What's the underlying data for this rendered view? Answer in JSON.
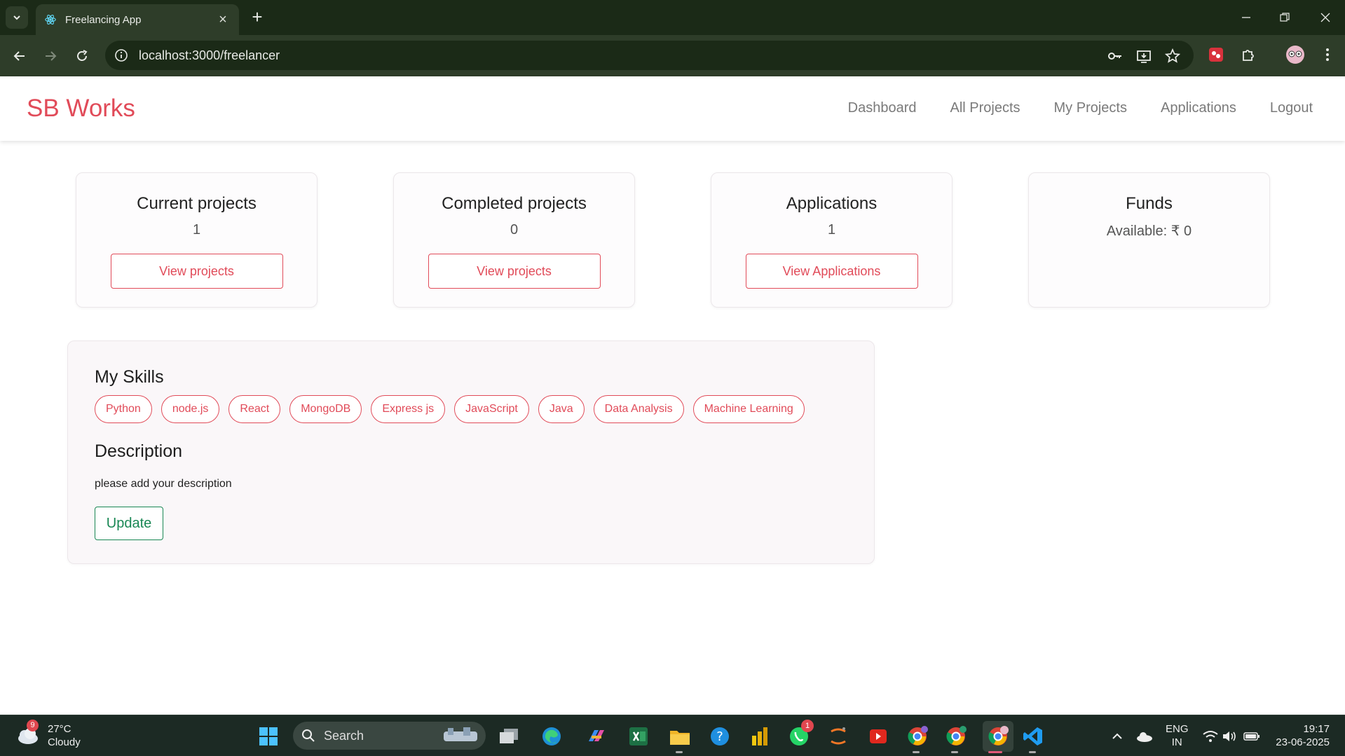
{
  "browser": {
    "tab_title": "Freelancing App",
    "url": "localhost:3000/freelancer"
  },
  "app": {
    "brand": "SB Works",
    "nav": [
      "Dashboard",
      "All Projects",
      "My Projects",
      "Applications",
      "Logout"
    ]
  },
  "cards": [
    {
      "title": "Current projects",
      "value": "1",
      "button": "View projects"
    },
    {
      "title": "Completed projects",
      "value": "0",
      "button": "View projects"
    },
    {
      "title": "Applications",
      "value": "1",
      "button": "View Applications"
    },
    {
      "title": "Funds",
      "value": "Available: ₹ 0"
    }
  ],
  "profile": {
    "skills_heading": "My Skills",
    "skills": [
      "Python",
      "node.js",
      "React",
      "MongoDB",
      "Express js",
      "JavaScript",
      "Java",
      "Data Analysis",
      "Machine Learning"
    ],
    "description_heading": "Description",
    "description": "please add your description",
    "update_label": "Update"
  },
  "taskbar": {
    "weather_temp": "27°C",
    "weather_desc": "Cloudy",
    "weather_badge": "9",
    "search_label": "Search",
    "whatsapp_badge": "1",
    "lang_line1": "ENG",
    "lang_line2": "IN",
    "time": "19:17",
    "date": "23-06-2025"
  },
  "colors": {
    "accent": "#e14b59",
    "success": "#198754",
    "chrome_dark": "#1b2a17",
    "chrome_mid": "#2e3d29"
  }
}
